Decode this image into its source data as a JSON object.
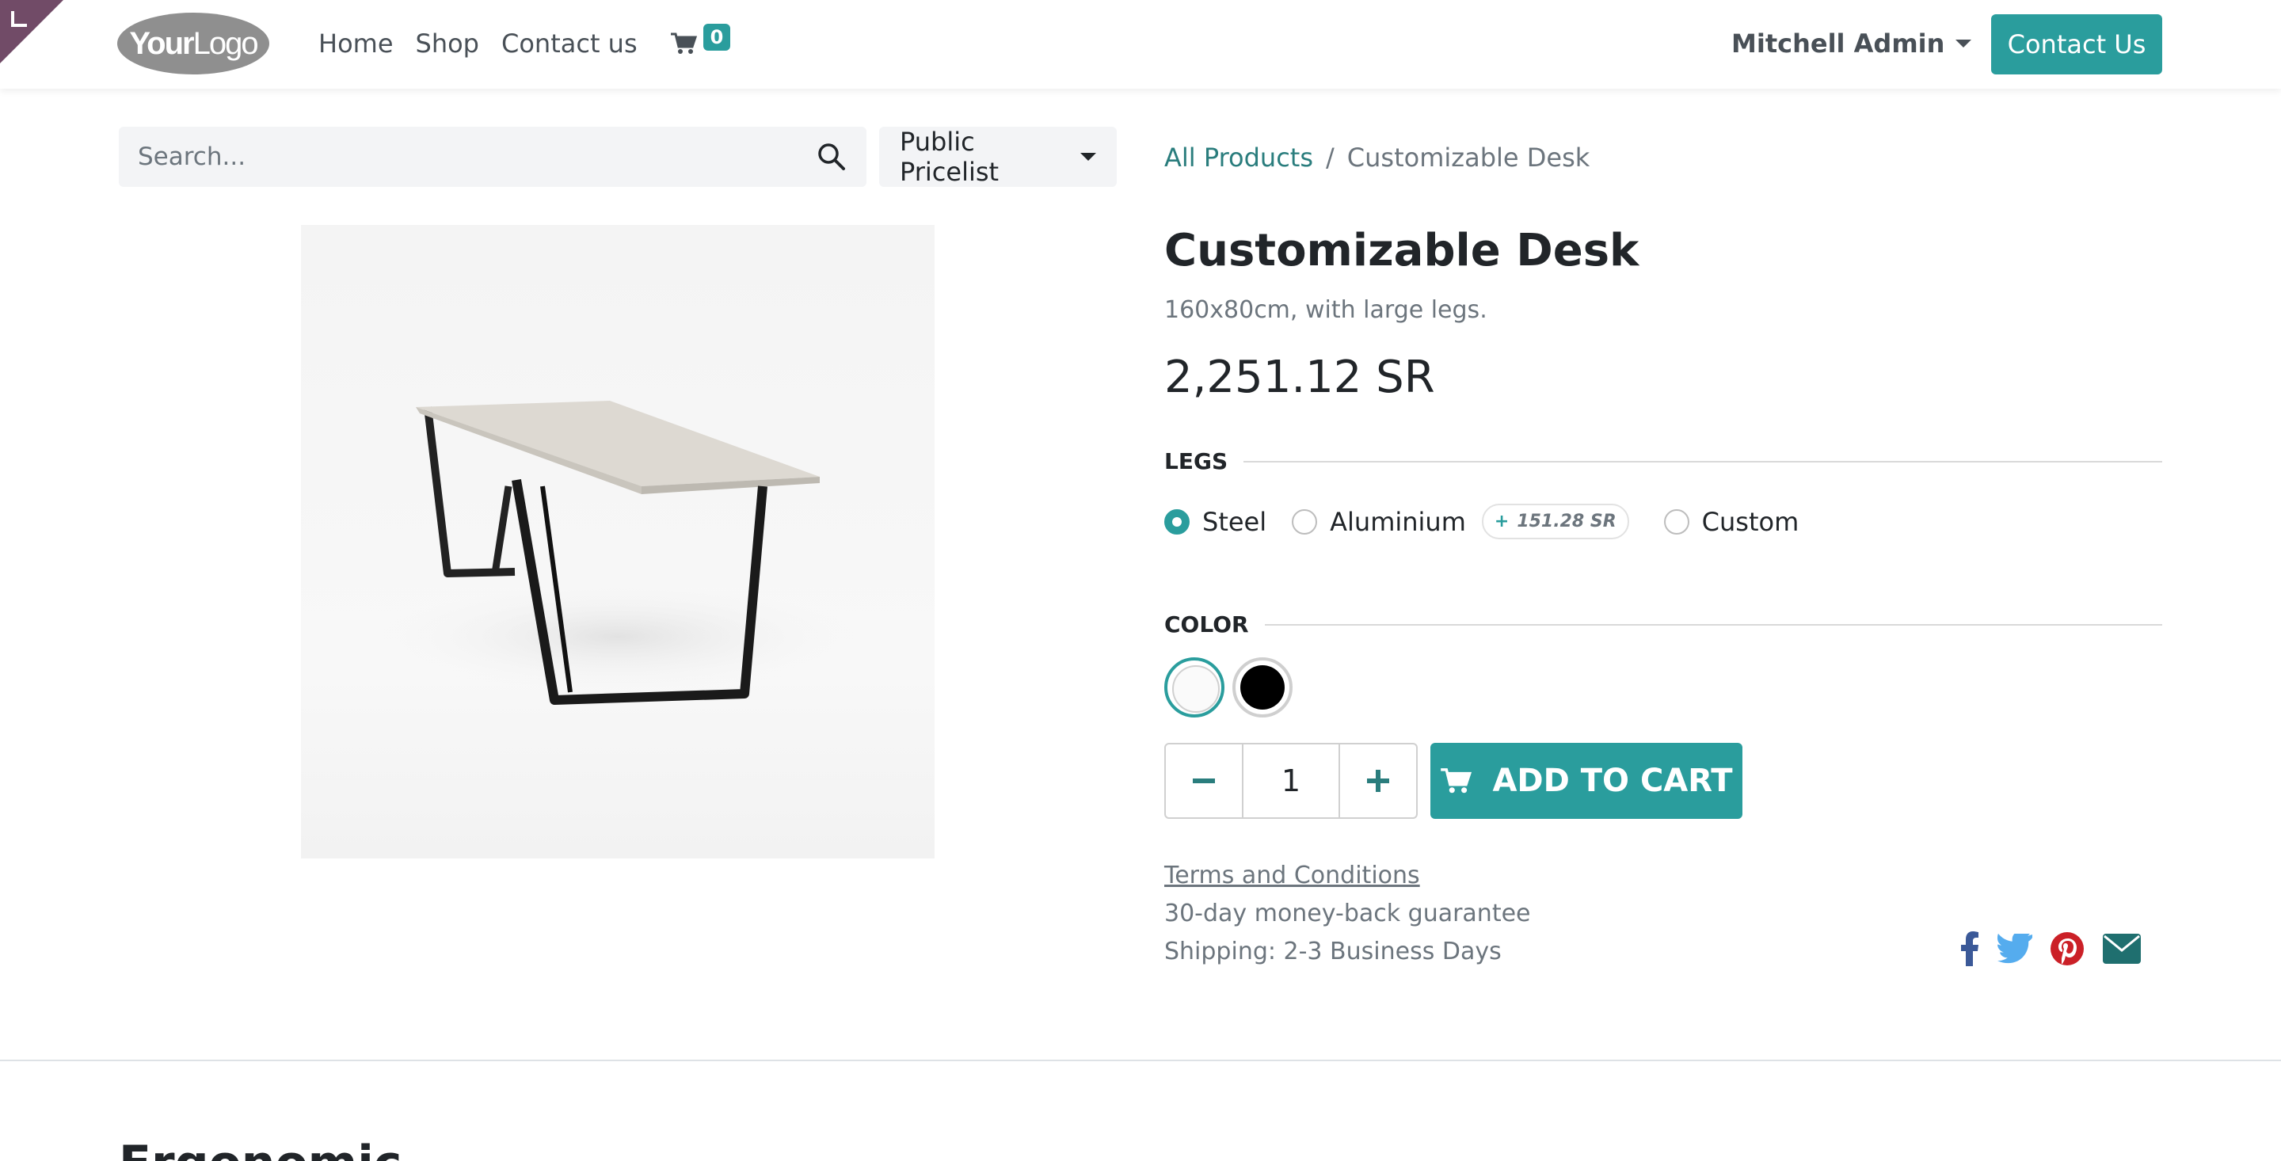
{
  "header": {
    "logo_word_bold": "Your",
    "logo_word_light": "Logo",
    "nav": [
      "Home",
      "Shop",
      "Contact us"
    ],
    "cart_count": "0",
    "user_name": "Mitchell Admin",
    "contact_button": "Contact Us"
  },
  "search": {
    "placeholder": "Search...",
    "pricelist": "Public Pricelist"
  },
  "breadcrumb": {
    "parent": "All Products",
    "separator": "/",
    "current": "Customizable Desk"
  },
  "product": {
    "name": "Customizable Desk",
    "description": "160x80cm, with large legs.",
    "price": "2,251.12 SR",
    "attributes": {
      "legs_label": "LEGS",
      "legs_options": [
        {
          "label": "Steel",
          "selected": true
        },
        {
          "label": "Aluminium",
          "extra": "151.28 SR",
          "selected": false
        },
        {
          "label": "Custom",
          "selected": false
        }
      ],
      "extra_sign": "+",
      "color_label": "COLOR",
      "colors": [
        {
          "name": "White",
          "hex": "#ffffff",
          "selected": true
        },
        {
          "name": "Black",
          "hex": "#000000",
          "selected": false
        }
      ]
    },
    "quantity": "1",
    "add_to_cart": "ADD TO CART",
    "terms": "Terms and Conditions",
    "guarantee": "30-day money-back guarantee",
    "shipping": "Shipping: 2-3 Business Days"
  },
  "social": [
    "facebook-icon",
    "twitter-icon",
    "pinterest-icon",
    "email-icon"
  ],
  "section": {
    "heading": "Ergonomic"
  },
  "colors": {
    "accent": "#2a9d9d",
    "brand": "#714B67",
    "facebook": "#3b5998",
    "twitter": "#55acee",
    "pinterest": "#cb2027",
    "email": "#1f6f6f"
  }
}
